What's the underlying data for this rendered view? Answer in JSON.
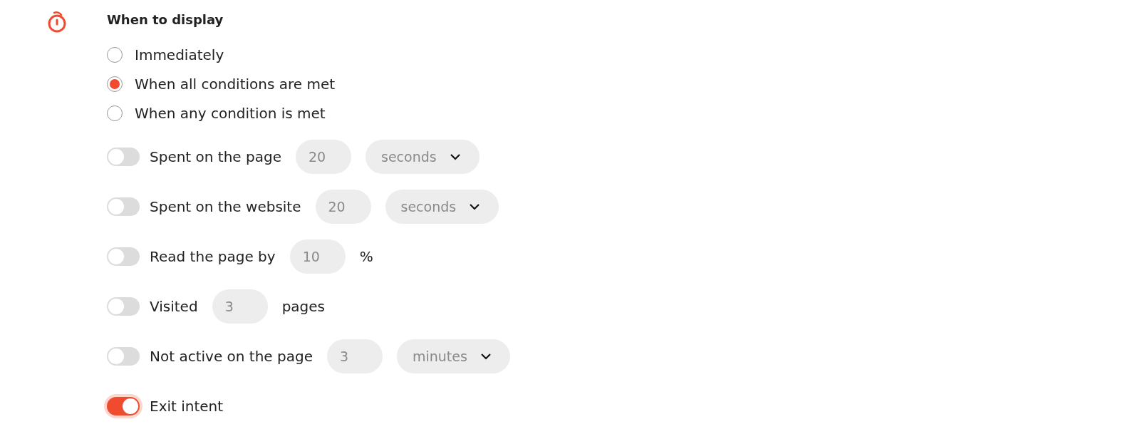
{
  "section": {
    "title": "When to display"
  },
  "display_options": [
    {
      "label": "Immediately",
      "selected": false
    },
    {
      "label": "When all conditions are met",
      "selected": true
    },
    {
      "label": "When any condition is met",
      "selected": false
    }
  ],
  "conditions": [
    {
      "label": "Spent on the page",
      "on": false,
      "value": "20",
      "unit": "seconds",
      "kind": "select"
    },
    {
      "label": "Spent on the website",
      "on": false,
      "value": "20",
      "unit": "seconds",
      "kind": "select"
    },
    {
      "label": "Read the page by",
      "on": false,
      "value": "10",
      "unit": "%",
      "kind": "text"
    },
    {
      "label": "Visited",
      "on": false,
      "value": "3",
      "unit": "pages",
      "kind": "text"
    },
    {
      "label": "Not active on the page",
      "on": false,
      "value": "3",
      "unit": "minutes",
      "kind": "select"
    },
    {
      "label": "Exit intent",
      "on": true
    }
  ]
}
